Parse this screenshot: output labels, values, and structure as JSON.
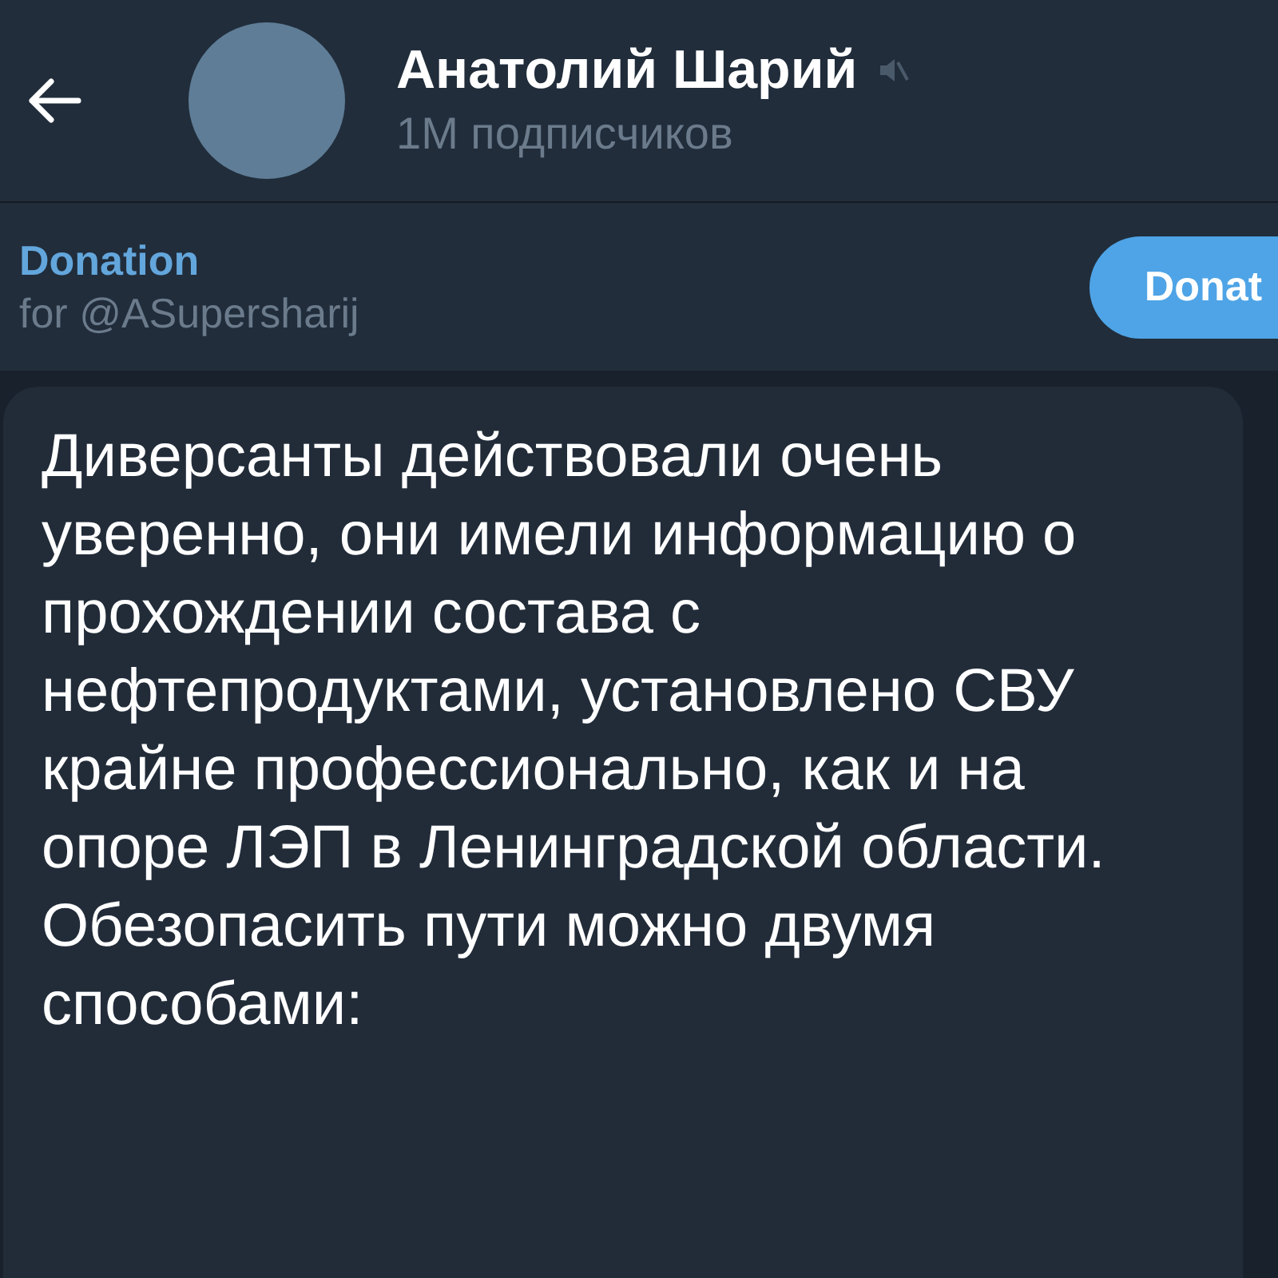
{
  "header": {
    "channel_name": "Анатолий Шарий",
    "muted": true,
    "subscribers": "1M подписчиков"
  },
  "pinned": {
    "title": "Donation",
    "subtitle": "for @ASupersharij",
    "button": "Donat"
  },
  "message": {
    "text": "Диверсанты действовали очень уверенно, они имели информацию о прохождении состава с нефтепродуктами, установлено СВУ крайне профессионально, как и на опоре ЛЭП в Ленинградской области. Обезопасить пути можно двумя способами:"
  }
}
